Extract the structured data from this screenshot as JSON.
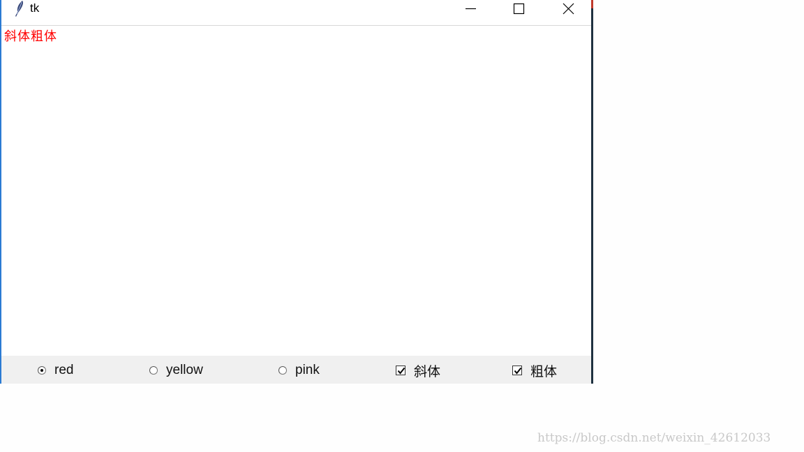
{
  "window": {
    "title": "tk",
    "icon": "feather-icon",
    "controls": [
      "minimize-icon",
      "maximize-icon",
      "close-icon"
    ]
  },
  "text_area": {
    "content": "斜体粗体",
    "text_color": "#ff0000"
  },
  "color_options": [
    {
      "label": "red",
      "selected": true
    },
    {
      "label": "yellow",
      "selected": false
    },
    {
      "label": "pink",
      "selected": false
    }
  ],
  "style_options": [
    {
      "label": "斜体",
      "checked": true
    },
    {
      "label": "粗体",
      "checked": true
    }
  ],
  "watermark": "https://blog.csdn.net/weixin_42612033",
  "colors": {
    "window_border": "#2b7bd3",
    "controls_bg": "#f0f0f0",
    "text_red": "#ff0000"
  }
}
